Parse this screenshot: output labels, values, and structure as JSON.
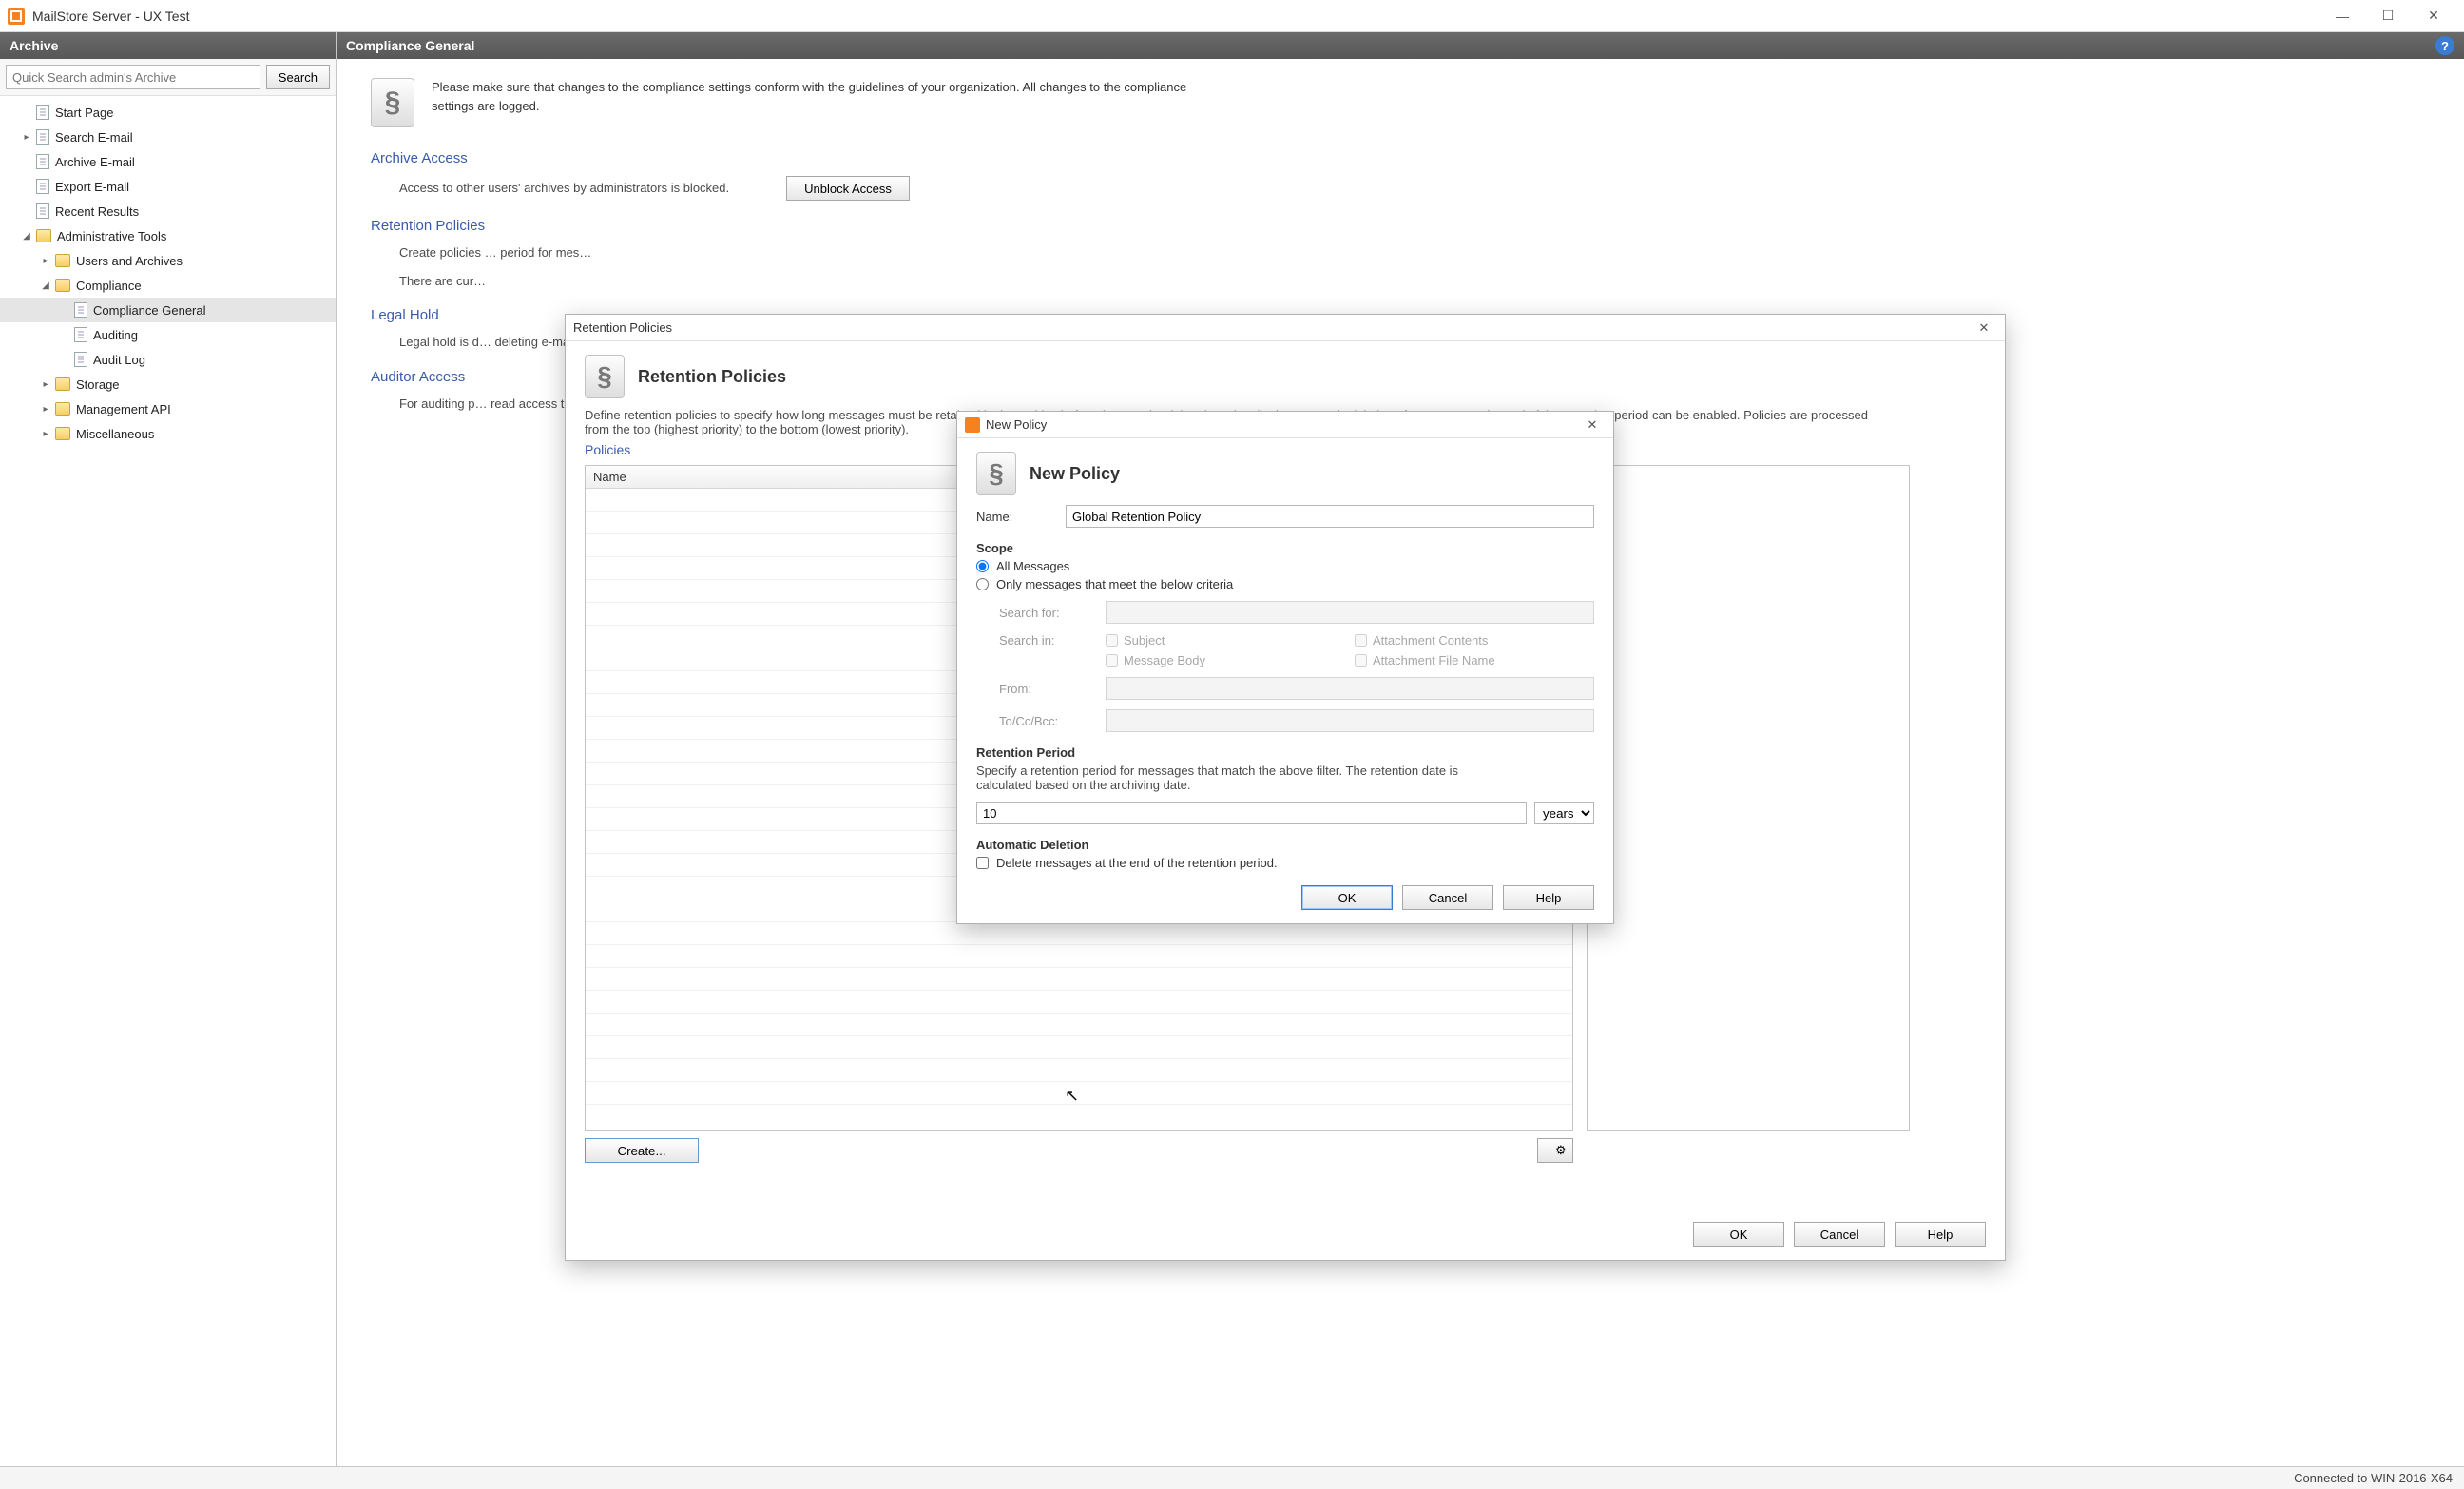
{
  "window": {
    "title": "MailStore Server - UX Test",
    "minimize": "—",
    "maximize": "☐",
    "close": "✕"
  },
  "sidebar": {
    "header": "Archive",
    "search_placeholder": "Quick Search admin's Archive",
    "search_btn": "Search",
    "items": [
      {
        "label": "Start Page"
      },
      {
        "label": "Search E-mail"
      },
      {
        "label": "Archive E-mail"
      },
      {
        "label": "Export E-mail"
      },
      {
        "label": "Recent Results"
      },
      {
        "label": "Administrative Tools",
        "children": [
          {
            "label": "Users and Archives"
          },
          {
            "label": "Compliance",
            "children": [
              {
                "label": "Compliance General",
                "selected": true
              },
              {
                "label": "Auditing"
              },
              {
                "label": "Audit Log"
              }
            ]
          },
          {
            "label": "Storage"
          },
          {
            "label": "Management API"
          },
          {
            "label": "Miscellaneous"
          }
        ]
      }
    ]
  },
  "content": {
    "header": "Compliance General",
    "intro": "Please make sure that changes to the compliance settings conform with the guidelines of your organization. All changes to the compliance settings are logged.",
    "sections": {
      "archive_access": {
        "title": "Archive Access",
        "body": "Access to other users' archives by administrators is blocked.",
        "button": "Unblock Access"
      },
      "retention": {
        "title": "Retention Policies",
        "body": "Create policies … period for mes…",
        "count": "There are cur…"
      },
      "legal_hold": {
        "title": "Legal Hold",
        "body": "Legal hold is d… deleting e-mai…"
      },
      "auditor": {
        "title": "Auditor Access",
        "body": "For auditing p… read access t…"
      }
    }
  },
  "retention_dialog": {
    "title": "Retention Policies",
    "header": "Retention Policies",
    "desc": "Define retention policies to specify how long messages must be retained in the archive before they can be deleted. Optionally the automatic deletion of messages at the end of the retention period can be enabled. Policies are processed from the top (highest priority) to the bottom (lowest priority).",
    "sub_title": "Policies",
    "col_name": "Name",
    "create_btn": "Create...",
    "ok": "OK",
    "cancel": "Cancel",
    "help": "Help"
  },
  "new_policy": {
    "title": "New Policy",
    "header": "New Policy",
    "name_label": "Name:",
    "name_value": "Global Retention Policy",
    "scope_header": "Scope",
    "scope_all": "All Messages",
    "scope_criteria": "Only messages that meet the below criteria",
    "search_for": "Search for:",
    "search_in": "Search in:",
    "chk_subject": "Subject",
    "chk_attach_contents": "Attachment Contents",
    "chk_body": "Message Body",
    "chk_attach_name": "Attachment File Name",
    "from": "From:",
    "to": "To/Cc/Bcc:",
    "period_header": "Retention Period",
    "period_desc": "Specify a retention period for messages that match the above filter. The retention date is calculated based on the archiving date.",
    "period_value": "10",
    "period_unit": "years",
    "auto_header": "Automatic Deletion",
    "auto_label": "Delete messages at the end of the retention period.",
    "ok": "OK",
    "cancel": "Cancel",
    "help": "Help"
  },
  "status": {
    "text": "Connected to WIN-2016-X64"
  }
}
